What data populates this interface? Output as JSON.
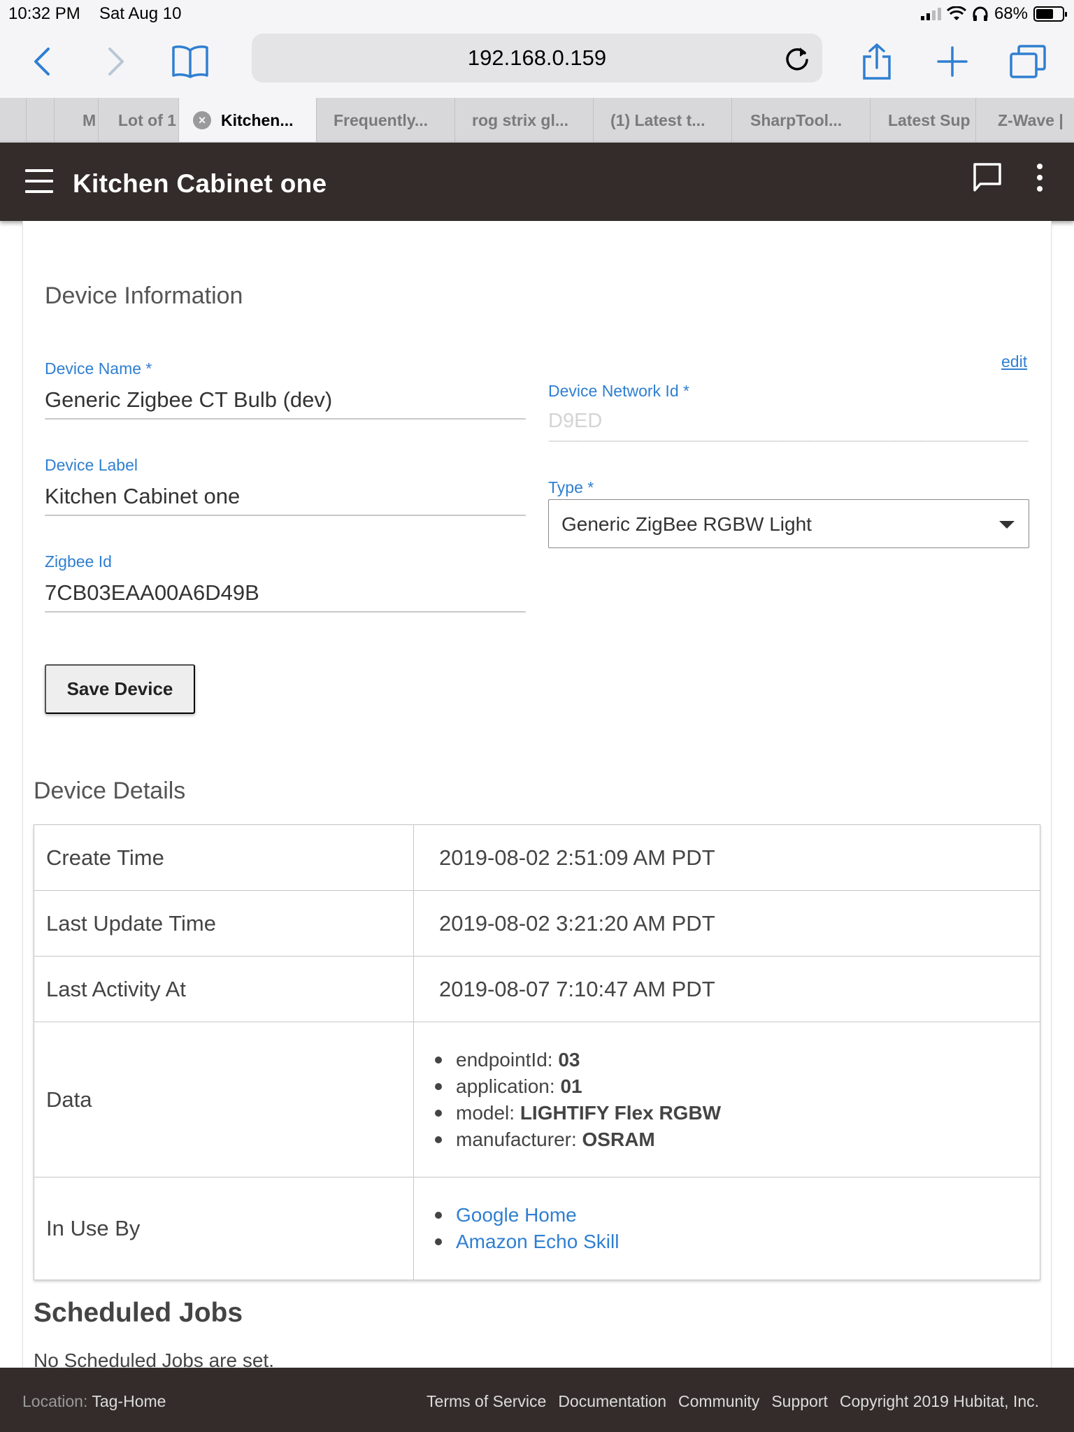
{
  "status_bar": {
    "time": "10:32 PM",
    "date": "Sat Aug 10",
    "battery": "68%"
  },
  "browser": {
    "url": "192.168.0.159",
    "tabs": [
      {
        "label": "M"
      },
      {
        "label": "Lot of 1"
      },
      {
        "label": "Kitchen..."
      },
      {
        "label": "Frequently..."
      },
      {
        "label": "rog strix gl..."
      },
      {
        "label": "(1) Latest t..."
      },
      {
        "label": "SharpTool..."
      },
      {
        "label": "Latest Sup"
      },
      {
        "label": "Z-Wave |"
      }
    ],
    "tab_close_glyph": "×"
  },
  "app_bar": {
    "title": "Kitchen Cabinet one"
  },
  "device_info": {
    "section_title": "Device Information",
    "edit_link": "edit",
    "device_name_label": "Device Name *",
    "device_name_value": "Generic Zigbee CT Bulb (dev)",
    "device_label_label": "Device Label",
    "device_label_value": "Kitchen Cabinet one",
    "zigbee_id_label": "Zigbee Id",
    "zigbee_id_value": "7CB03EAA00A6D49B",
    "network_id_label": "Device Network Id *",
    "network_id_value": "D9ED",
    "type_label": "Type *",
    "type_value": "Generic ZigBee RGBW Light",
    "save_button": "Save Device"
  },
  "device_details": {
    "section_title": "Device Details",
    "create_time_key": "Create Time",
    "create_time_value": "2019-08-02 2:51:09 AM PDT",
    "last_update_key": "Last Update Time",
    "last_update_value": "2019-08-02 3:21:20 AM PDT",
    "last_activity_key": "Last Activity At",
    "last_activity_value": "2019-08-07 7:10:47 AM PDT",
    "data_key": "Data",
    "data_items": [
      {
        "name": "endpointId:",
        "value": "03"
      },
      {
        "name": "application:",
        "value": "01"
      },
      {
        "name": "model:",
        "value": "LIGHTIFY Flex RGBW"
      },
      {
        "name": "manufacturer:",
        "value": "OSRAM"
      }
    ],
    "in_use_key": "In Use By",
    "in_use_items": [
      {
        "label": "Google Home"
      },
      {
        "label": "Amazon Echo Skill"
      }
    ]
  },
  "scheduled_jobs": {
    "title": "Scheduled Jobs",
    "empty_text": "No Scheduled Jobs are set."
  },
  "footer": {
    "location_label": "Location:",
    "location_value": "Tag-Home",
    "links": [
      {
        "label": "Terms of Service"
      },
      {
        "label": "Documentation"
      },
      {
        "label": "Community"
      },
      {
        "label": "Support"
      },
      {
        "label": "Copyright 2019 Hubitat, Inc."
      }
    ]
  },
  "colors": {
    "app_bar": "#332c2a",
    "accent_blue": "#2f7fd1"
  }
}
